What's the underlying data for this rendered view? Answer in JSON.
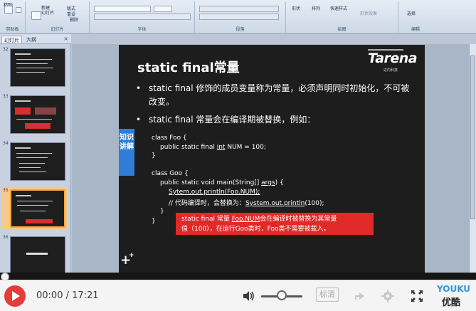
{
  "ribbon": {
    "paste": "粘贴",
    "new_slide": "新建\n幻灯片",
    "layout": "版式",
    "reset": "重设",
    "delete": "删除",
    "shapes": "形状",
    "arrange": "排列",
    "quick_styles": "快速样式",
    "shape_outline": "形状效果",
    "select": "选择",
    "groups": {
      "clipboard": "剪贴板",
      "slides": "幻灯片",
      "font": "字体",
      "paragraph": "段落",
      "drawing": "绘图",
      "editing": "编辑"
    }
  },
  "panel_tabs": {
    "slides": "幻灯片",
    "outline": "大纲",
    "close": "×"
  },
  "thumbnails": [
    {
      "num": "32"
    },
    {
      "num": "33"
    },
    {
      "num": "34"
    },
    {
      "num": "35"
    },
    {
      "num": "36",
      "title": "内部类简介"
    }
  ],
  "slide": {
    "title": "static  final常量",
    "logo": "Tarena",
    "logo_sub": "达内科技",
    "side_tag": "知识讲解",
    "bullets": [
      "static final 修饰的成员变量称为常量，必须声明同时初始化，不可被改变。",
      "static final 常量会在编译期被替换，例如："
    ],
    "bullet_glyph": "•",
    "code": {
      "line1": "class Foo {",
      "line2a": "public static final ",
      "line2b": "int",
      "line2c": " NUM = 100;",
      "line3": "}",
      "line4": "class Goo {",
      "line5a": "public static void main(String[] ",
      "line5b": "args",
      "line5c": ") {",
      "line6": "Sytem.out.println(Foo.NUM);",
      "line7a": "// 代码编译时，会替换为：",
      "line7b": "System.out.println",
      "line7c": "(100);",
      "line8": "}",
      "line9": "}"
    },
    "callout": {
      "line1a": "static final 常量 ",
      "line1b": "Foo.NUM",
      "line1c": "会在编译时被替换为其常量",
      "line2": "值（100），在运行Goo类时，Foo类不需要被载入。"
    }
  },
  "player": {
    "time": "00:00 / 17:21",
    "progress": 0.0,
    "volume": 0.5,
    "quality": "标清",
    "brand": "YOUKU",
    "brand_cn": "优酷",
    "colors": {
      "play": "#e43b3b",
      "brand_blue": "#2a9ae0",
      "brand_red": "#e84a2f"
    }
  }
}
